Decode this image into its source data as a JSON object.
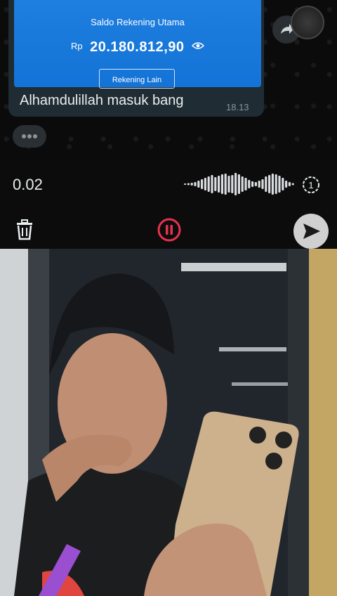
{
  "chat": {
    "bank_card": {
      "title": "Saldo Rekening Utama",
      "currency": "Rp",
      "amount": "20.180.812,90",
      "other_accounts_button": "Rekening Lain"
    },
    "message_text": "Alhamdulillah masuk bang",
    "message_time": "18.13"
  },
  "recording": {
    "elapsed": "0.02",
    "speed_label": "1"
  },
  "colors": {
    "bank_blue": "#1a7ae0",
    "pause_red": "#e8314d",
    "bubble": "#1f2c34"
  }
}
